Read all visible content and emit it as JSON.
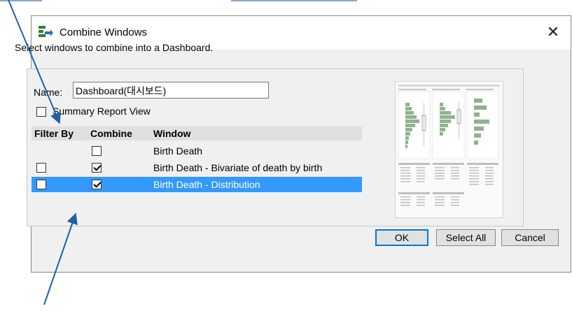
{
  "dialog": {
    "title": "Combine Windows",
    "close_glyph": "✕",
    "instruction": "Select windows to combine into a Dashboard."
  },
  "form": {
    "name_label": "Name:",
    "name_value": "Dashboard(대시보드)",
    "summary_label": "Summary Report View",
    "summary_checked": false
  },
  "table": {
    "headers": [
      "Filter By",
      "Combine",
      "Window"
    ],
    "rows": [
      {
        "window": "Birth Death",
        "filter_by": null,
        "combine": false,
        "selected": false
      },
      {
        "window": "Birth Death - Bivariate of death by birth",
        "filter_by": false,
        "combine": true,
        "selected": false
      },
      {
        "window": "Birth Death - Distribution",
        "filter_by": false,
        "combine": true,
        "selected": true
      }
    ]
  },
  "buttons": {
    "ok": "OK",
    "select_all": "Select All",
    "cancel": "Cancel"
  },
  "colors": {
    "selection": "#3399ff",
    "arrow": "#1f5fa8",
    "preview_bars": "#8fb38f"
  },
  "icons": {
    "app": "combine-windows-icon",
    "close": "close-icon"
  }
}
